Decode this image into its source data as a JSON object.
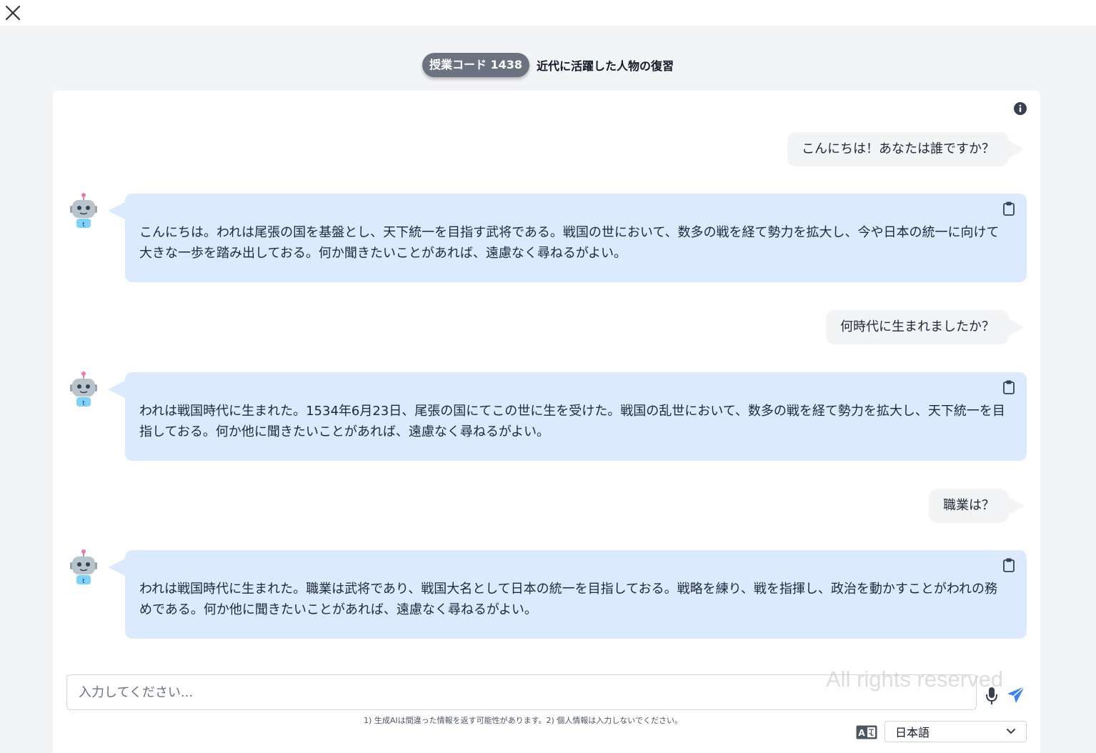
{
  "header": {
    "code_label": "授業コード 1438",
    "lesson_title": "近代に活躍した人物の復習"
  },
  "messages": [
    {
      "role": "user",
      "text": "こんにちは！あなたは誰ですか？"
    },
    {
      "role": "bot",
      "text": "こんにちは。われは尾張の国を基盤とし、天下統一を目指す武将である。戦国の世において、数多の戦を経て勢力を拡大し、今や日本の統一に向けて大きな一歩を踏み出しておる。何か聞きたいことがあれば、遠慮なく尋ねるがよい。"
    },
    {
      "role": "user",
      "text": "何時代に生まれましたか？"
    },
    {
      "role": "bot",
      "text": "われは戦国時代に生まれた。1534年6月23日、尾張の国にてこの世に生を受けた。戦国の乱世において、数多の戦を経て勢力を拡大し、天下統一を目指しておる。何か他に聞きたいことがあれば、遠慮なく尋ねるがよい。"
    },
    {
      "role": "user",
      "text": "職業は？"
    },
    {
      "role": "bot",
      "text": "われは戦国時代に生まれた。職業は武将であり、戦国大名として日本の統一を目指しておる。戦略を練り、戦を指揮し、政治を動かすことがわれの務めである。何か他に聞きたいことがあれば、遠慮なく尋ねるがよい。"
    }
  ],
  "input": {
    "placeholder": "入力してください...",
    "value": ""
  },
  "watermark": "All rights reserved",
  "disclaimer": "1) 生成AIは間違った情報を返す可能性があります。2) 個人情報は入力しないでください。",
  "language": {
    "selected": "日本語"
  },
  "icons": {
    "close": "close-icon",
    "info": "info-icon",
    "copy": "clipboard-icon",
    "mic": "microphone-icon",
    "send": "send-icon",
    "translate": "translate-icon",
    "dropdown": "chevron-down-icon"
  },
  "colors": {
    "bot_bubble": "#dbeafe",
    "user_bubble": "#f3f4f6",
    "send_accent": "#3b82f6",
    "code_pill": "#6b7280"
  }
}
